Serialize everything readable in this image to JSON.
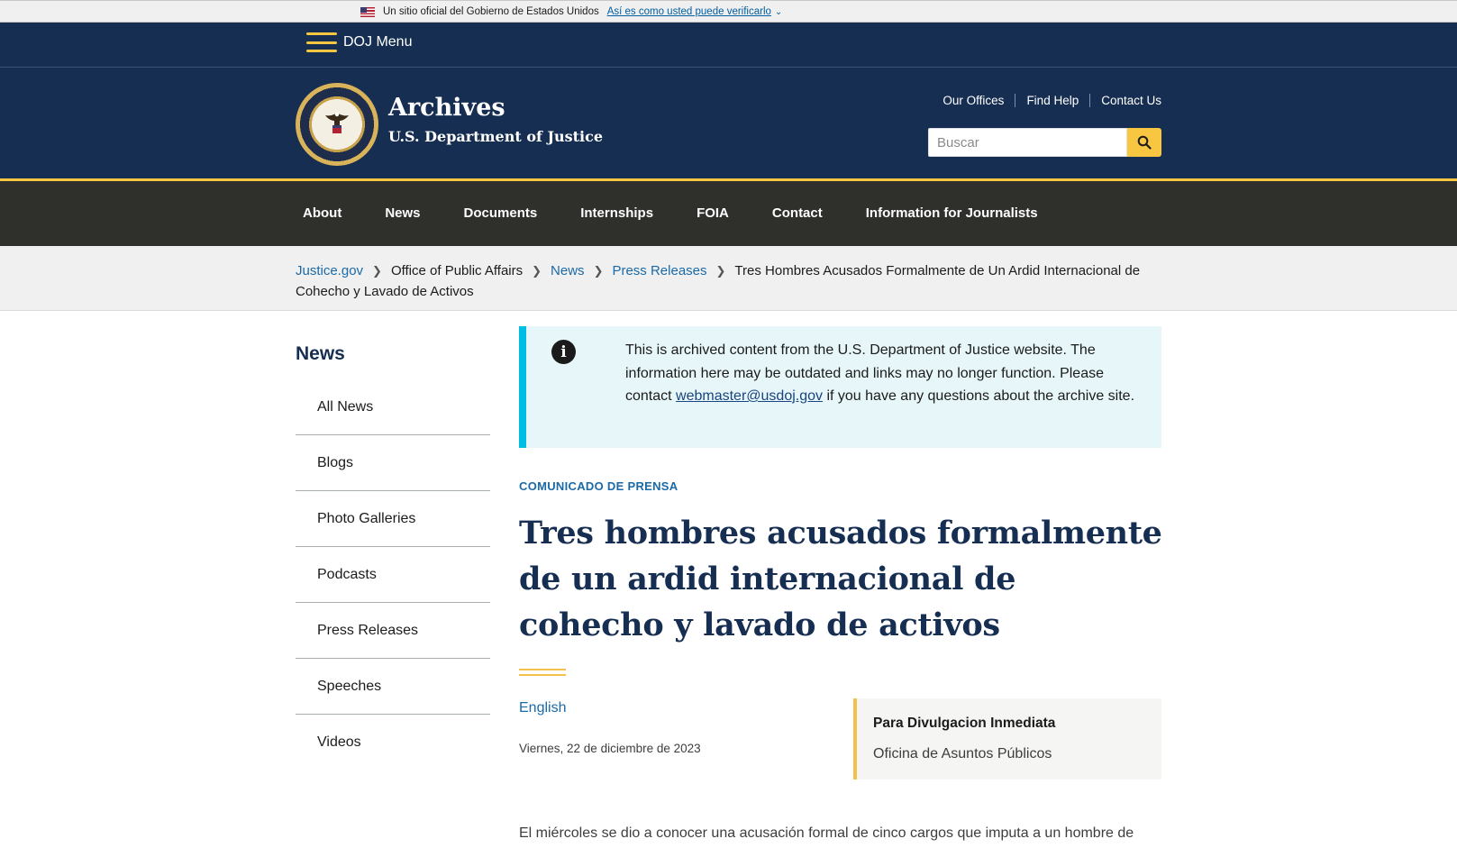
{
  "gov_banner": {
    "text": "Un sitio oficial del Gobierno de Estados Unidos",
    "link": "Así es como usted puede verificarlo"
  },
  "menu": {
    "label": "DOJ Menu"
  },
  "header": {
    "title": "Archives",
    "subtitle": "U.S. Department of Justice",
    "utility_links": [
      "Our Offices",
      "Find Help",
      "Contact Us"
    ],
    "search_placeholder": "Buscar"
  },
  "nav": {
    "items": [
      "About",
      "News",
      "Documents",
      "Internships",
      "FOIA",
      "Contact",
      "Information for Journalists"
    ]
  },
  "breadcrumb": {
    "items": [
      "Justice.gov",
      "Office of Public Affairs",
      "News",
      "Press Releases"
    ],
    "current": "Tres Hombres Acusados Formalmente de Un Ardid Internacional de Cohecho y Lavado de Activos"
  },
  "sidebar": {
    "title": "News",
    "items": [
      "All News",
      "Blogs",
      "Photo Galleries",
      "Podcasts",
      "Press Releases",
      "Speeches",
      "Videos"
    ]
  },
  "alert": {
    "text_before": "This is archived content from the U.S. Department of Justice website. The information here may be outdated and links may no longer function. Please contact ",
    "email": "webmaster@usdoj.gov",
    "text_after": " if you have any questions about the archive site."
  },
  "article": {
    "kicker": "COMUNICADO DE PRENSA",
    "title": "Tres hombres acusados formalmente de un ardid internacional de cohecho y lavado de activos",
    "language_link": "English",
    "date": "Viernes, 22 de diciembre de 2023",
    "release_label": "Para Divulgacion Inmediata",
    "office": "Oficina de Asuntos Públicos",
    "body_start": "El miércoles se dio a conocer una acusación formal de cinco cargos que imputa a un hombre de"
  },
  "colors": {
    "navy": "#162e51",
    "gold": "#f9c642",
    "nav_bg": "#2f2f2c",
    "link": "#1a6aa8",
    "alert_bg": "#e7f6f8",
    "alert_border": "#00bde3"
  }
}
